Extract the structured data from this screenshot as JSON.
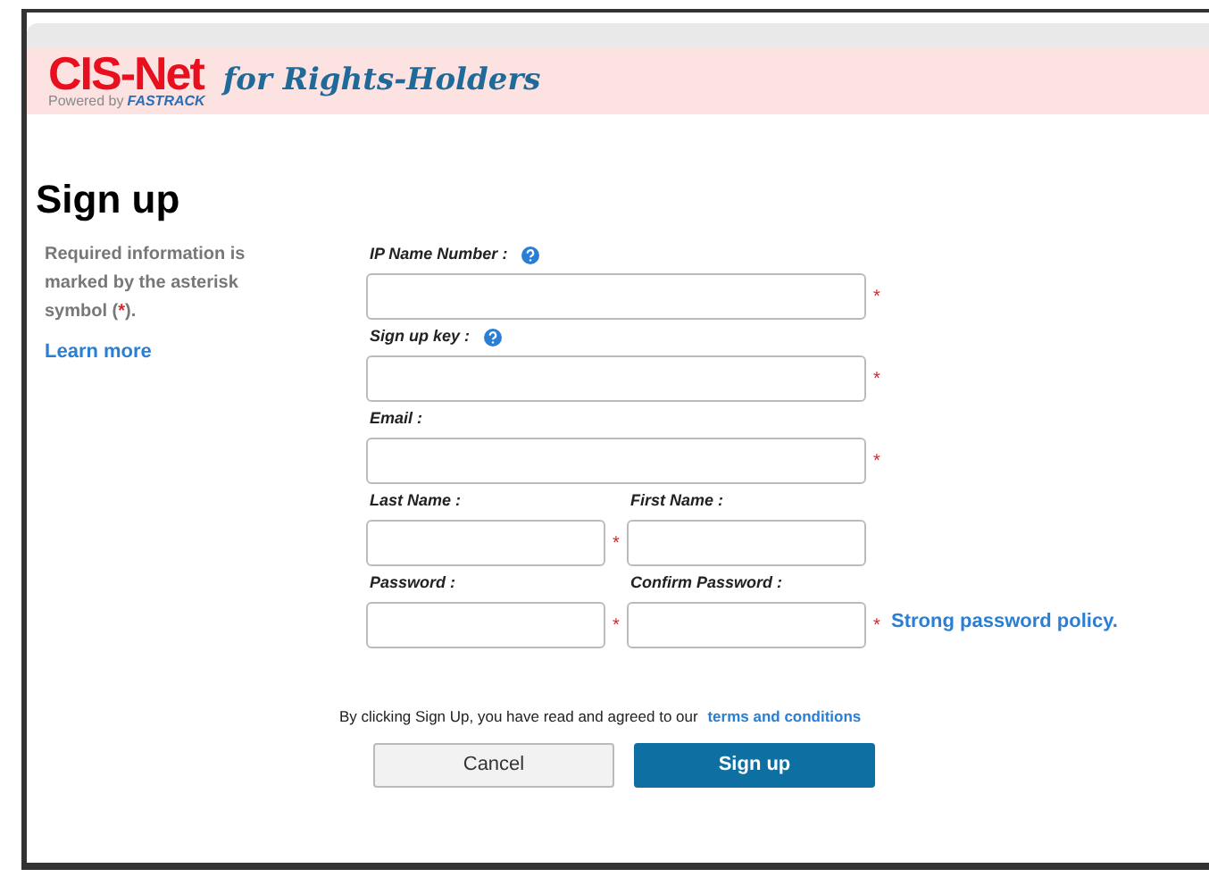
{
  "header": {
    "logo": "CIS-Net",
    "powered_by": "Powered by",
    "brand": "FASTRACK",
    "tagline": "for Rights-Holders"
  },
  "title": "Sign up",
  "note": {
    "before": "Required information is marked by the asterisk symbol (",
    "mark": "*",
    "after": ")."
  },
  "learn_more": "Learn more",
  "rows": [
    {
      "fields": [
        {
          "label": "IP Name Number :",
          "help": true,
          "required": true
        }
      ]
    },
    {
      "fields": [
        {
          "label": "Sign up key :",
          "help": true,
          "required": true
        }
      ]
    },
    {
      "fields": [
        {
          "label": "Email :",
          "help": false,
          "required": true
        }
      ]
    },
    {
      "fields": [
        {
          "label": "Last Name :",
          "help": false,
          "required": true
        },
        {
          "label": "First Name :",
          "help": false,
          "required": false
        }
      ]
    },
    {
      "fields": [
        {
          "label": "Password :",
          "help": false,
          "required": true
        },
        {
          "label": "Confirm Password :",
          "help": false,
          "required": true
        }
      ],
      "link": "Strong password policy."
    }
  ],
  "consent": {
    "text": "By clicking Sign Up, you have read and agreed to our",
    "link": "terms and conditions"
  },
  "buttons": {
    "cancel": "Cancel",
    "submit": "Sign up"
  }
}
